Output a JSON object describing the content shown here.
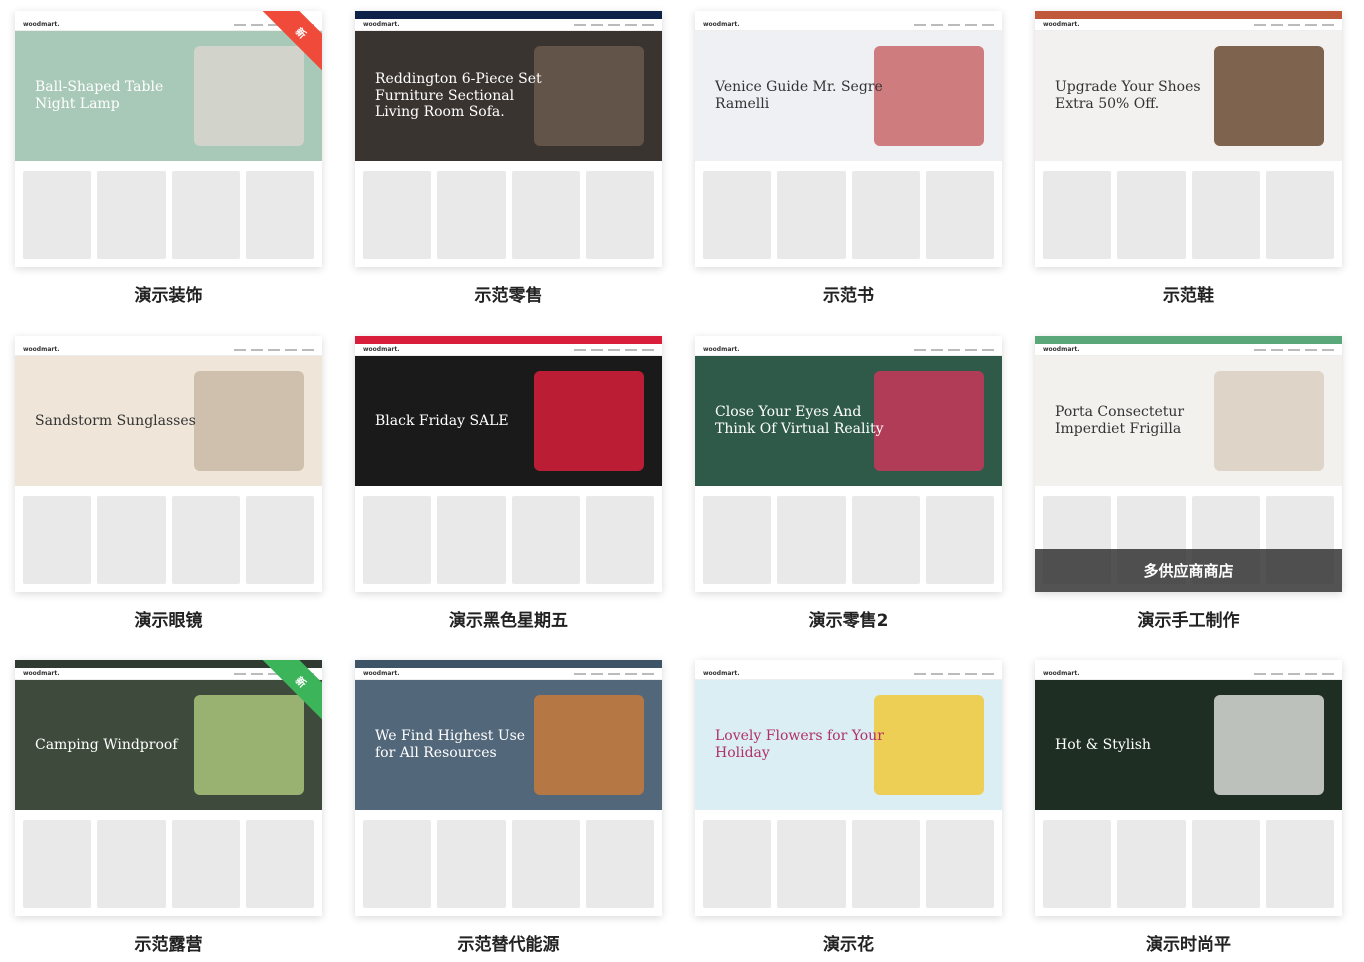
{
  "accent_new_red": "#f04a3a",
  "accent_new_green": "#3cb55a",
  "cards": [
    {
      "caption": "演示装饰",
      "logo": "woodmart.",
      "headline": "Ball-Shaped Table Night Lamp",
      "top": "#ffffff",
      "hero": "#a8c9b8",
      "art": "#d9d5cc",
      "ink": "#fff",
      "ribbon": "新",
      "ribbon_color": "#f04a3a"
    },
    {
      "caption": "示范零售",
      "logo": "woodmart.",
      "headline": "Reddington 6-Piece Set Furniture Sectional Living Room Sofa.",
      "top": "#0d2149",
      "hero": "#3a3430",
      "art": "#6b5b4e",
      "ink": "#fff"
    },
    {
      "caption": "示范书",
      "logo": "woodmart.",
      "headline": "Venice Guide Mr. Segre Ramelli",
      "top": "#ffffff",
      "hero": "#eef0f4",
      "art": "#c9676a",
      "ink": "#333"
    },
    {
      "caption": "示范鞋",
      "logo": "woodmart.",
      "headline": "Upgrade Your Shoes Extra 50% Off.",
      "top": "#c0583a",
      "hero": "#f2f1ef",
      "art": "#6a4a32",
      "ink": "#333"
    },
    {
      "caption": "演示眼镜",
      "logo": "woodmart.",
      "headline": "Sandstorm Sunglasses",
      "top": "#ffffff",
      "hero": "#efe6d9",
      "art": "#c8b9a5",
      "ink": "#333"
    },
    {
      "caption": "演示黑色星期五",
      "logo": "woodmart.",
      "headline": "Black Friday SALE",
      "top": "#d81e3a",
      "hero": "#1a1a1a",
      "art": "#d81e3a",
      "ink": "#fff"
    },
    {
      "caption": "演示零售2",
      "logo": "woodmart.",
      "headline": "Close Your Eyes And Think Of Virtual Reality",
      "top": "#ffffff",
      "hero": "#2f5a4a",
      "art": "#c8375b",
      "ink": "#fff"
    },
    {
      "caption": "演示手工制作",
      "logo": "woodmart.",
      "headline": "Porta Consectetur Imperdiet Frigilla",
      "top": "#5aa77a",
      "hero": "#f3f1ee",
      "art": "#d9cfc0",
      "ink": "#333",
      "overlay": "多供应商商店"
    },
    {
      "caption": "示范露营",
      "logo": "woodmart.",
      "headline": "Camping Windproof",
      "top": "#2f3a30",
      "hero": "#3e4b3c",
      "art": "#a9c47a",
      "ink": "#fff",
      "ribbon": "新",
      "ribbon_color": "#3cb55a"
    },
    {
      "caption": "示范替代能源",
      "logo": "woodmart.",
      "headline": "We Find Highest Use for All Resources",
      "top": "#3d5566",
      "hero": "#52677a",
      "art": "#c77a3a",
      "ink": "#fff"
    },
    {
      "caption": "演示花",
      "logo": "woodmart.",
      "headline": "Lovely Flowers for Your Holiday",
      "top": "#ffffff",
      "hero": "#dbeef4",
      "art": "#f0c93a",
      "ink": "#b0306a"
    },
    {
      "caption": "演示时尚平",
      "logo": "woodmart.",
      "headline": "Hot & Stylish",
      "top": "#ffffff",
      "hero": "#1f2e22",
      "art": "#d8dad6",
      "ink": "#fff"
    }
  ]
}
